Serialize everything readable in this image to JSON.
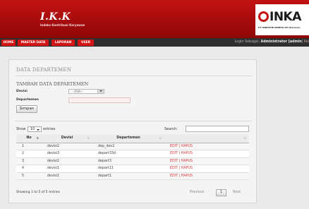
{
  "header": {
    "app_title": "I.K.K",
    "app_subtitle": "Indeks Kontribusi Karyawan",
    "inka_logo": "INKA",
    "inka_subtitle": "PT. INDUSTRI KERETA API (Persero)"
  },
  "nav": {
    "items": [
      {
        "label": "HOME"
      },
      {
        "label": "MASTER DATA"
      },
      {
        "label": "LAPORAN"
      },
      {
        "label": "USER"
      }
    ],
    "login_prefix": "Login Sebagai:",
    "login_user": "Administrator [admin",
    "login_sep": "|",
    "logout": "Kel"
  },
  "panel": {
    "title": "DATA DEPARTEMEN",
    "form_title": "TAMBAH DATA DEPARTEMEN",
    "divisi_label": "Devisi",
    "divisi_selected": "--Pilih--",
    "departemen_label": "Departemen",
    "departemen_value": "",
    "save_label": "Simpan"
  },
  "table": {
    "show_label": "Show",
    "show_value": "10",
    "entries_label": "entries",
    "search_label": "Search:",
    "search_value": "",
    "columns": [
      "No",
      "Devisi",
      "Departemen",
      ""
    ],
    "rows": [
      {
        "no": "1",
        "devisi": "devisi2",
        "departemen": "dep_dev2",
        "edit": "EDIT",
        "sep": "|",
        "hapus": "HAPUS"
      },
      {
        "no": "2",
        "devisi": "devisi3",
        "departemen": "depart33d",
        "edit": "EDIT",
        "sep": "|",
        "hapus": "HAPUS"
      },
      {
        "no": "3",
        "devisi": "devisi2",
        "departemen": "depart3",
        "edit": "EDIT",
        "sep": "|",
        "hapus": "HAPUS"
      },
      {
        "no": "4",
        "devisi": "devisi1",
        "departemen": "depart11",
        "edit": "EDIT",
        "sep": "|",
        "hapus": "HAPUS"
      },
      {
        "no": "5",
        "devisi": "devisi1",
        "departemen": "depart1",
        "edit": "EDIT",
        "sep": "|",
        "hapus": "HAPUS"
      }
    ],
    "info": "Showing 1 to 5 of 5 entries",
    "prev": "Previous",
    "page": "1",
    "next": "Next"
  },
  "colors": {
    "header_red": "#b80f0f",
    "nav_bg": "#2f2f2f",
    "nav_item": "#d31515",
    "link_red": "#e23a3a"
  },
  "icons": [
    "inka-ring-logo",
    "sort-icon",
    "dropdown-arrow-icon"
  ]
}
